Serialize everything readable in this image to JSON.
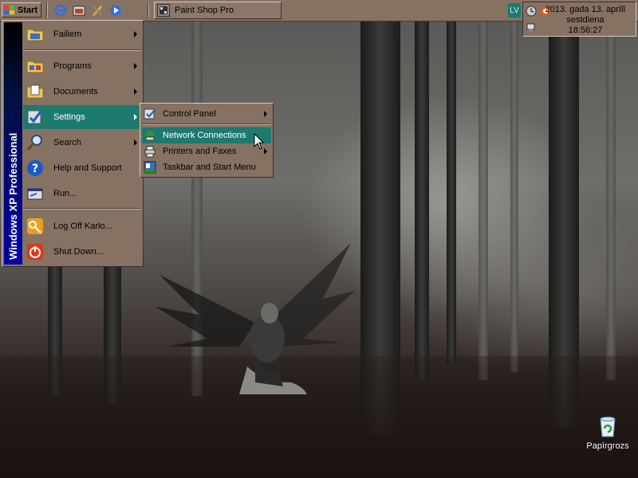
{
  "taskbar": {
    "start_label": "Start",
    "quick_launch": [
      "internet-explorer-icon",
      "movie-maker-icon",
      "tools-icon",
      "media-icon"
    ],
    "tasks": [
      {
        "label": "Paint Shop Pro",
        "icon": "paint-shop-pro-icon"
      }
    ],
    "language": "LV",
    "clock": {
      "date": "2013. gada 13. aprīlī",
      "day": "sestdiena",
      "time": "18:56:27"
    }
  },
  "start_menu": {
    "banner": "Windows XP Professional",
    "items": [
      {
        "label": "Failiem",
        "icon": "folder-icon",
        "submenu": true
      },
      {
        "label": "Programs",
        "icon": "programs-icon",
        "submenu": true
      },
      {
        "label": "Documents",
        "icon": "documents-icon",
        "submenu": true
      },
      {
        "label": "Settings",
        "icon": "settings-icon",
        "submenu": true,
        "selected": true
      },
      {
        "label": "Search",
        "icon": "search-icon",
        "submenu": true
      },
      {
        "label": "Help and Support",
        "icon": "help-icon",
        "submenu": false
      },
      {
        "label": "Run...",
        "icon": "run-icon",
        "submenu": false
      },
      {
        "label": "Log Off Karlo...",
        "icon": "log-off-icon",
        "submenu": false
      },
      {
        "label": "Shut Down...",
        "icon": "shut-down-icon",
        "submenu": false
      }
    ]
  },
  "settings_submenu": {
    "items": [
      {
        "label": "Control Panel",
        "icon": "control-panel-icon",
        "submenu": true
      },
      {
        "label": "Network Connections",
        "icon": "network-connections-icon",
        "submenu": false,
        "selected": true
      },
      {
        "label": "Printers and Faxes",
        "icon": "printers-icon",
        "submenu": true
      },
      {
        "label": "Taskbar and Start Menu",
        "icon": "taskbar-icon",
        "submenu": false
      }
    ]
  },
  "desktop": {
    "icons": [
      {
        "label": "Papīrgrozs",
        "icon": "recycle-bin-icon"
      }
    ]
  },
  "colors": {
    "taskbar": "#867263",
    "highlight": "#1c7a6e",
    "banner": "#0000a8"
  }
}
